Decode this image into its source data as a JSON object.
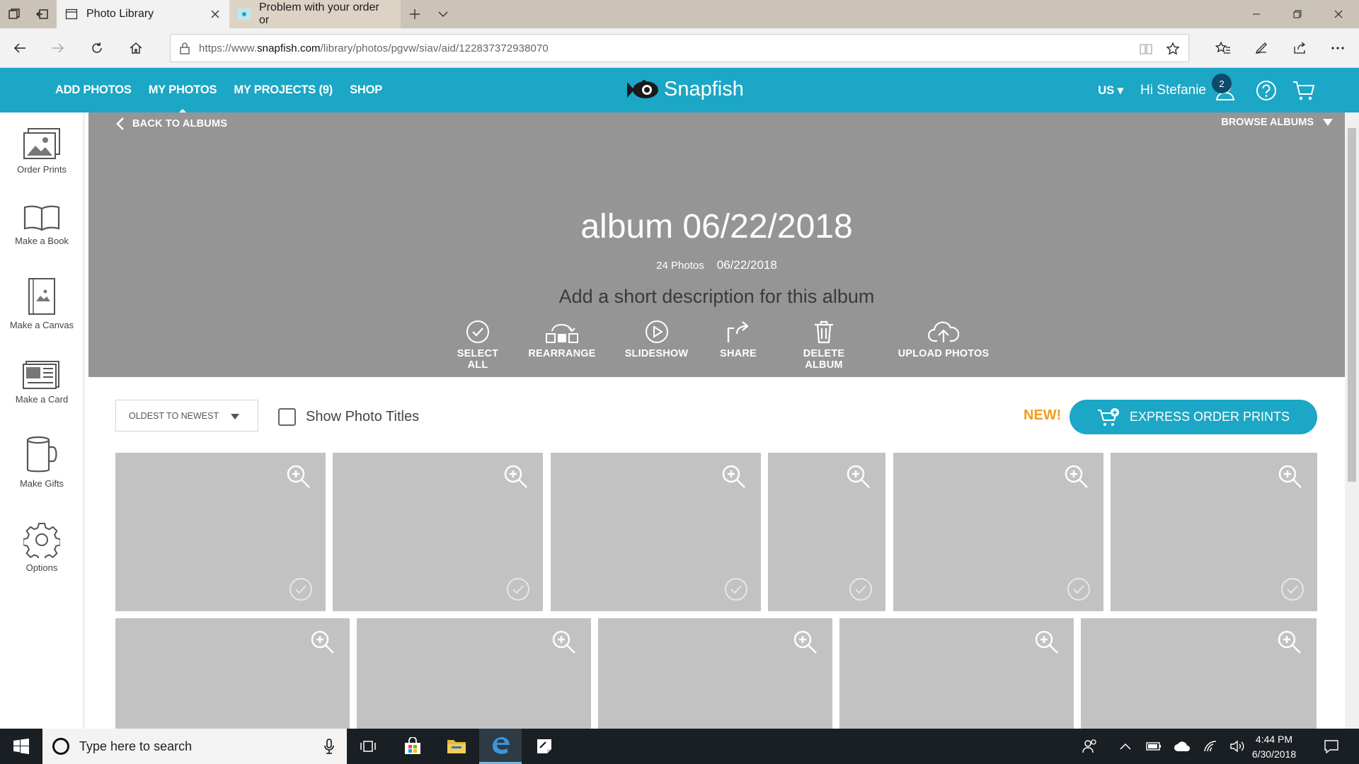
{
  "browser": {
    "tabs": [
      {
        "title": "Photo Library",
        "icon": "page-icon",
        "active": true
      },
      {
        "title": "Problem with your order or",
        "icon": "snapfish-favicon",
        "active": false
      }
    ],
    "url_prefix": "https://www.",
    "url_domain": "snapfish.com",
    "url_path": "/library/photos/pgvw/siav/aid/122837372938070"
  },
  "header": {
    "nav": [
      "ADD PHOTOS",
      "MY PHOTOS",
      "MY PROJECTS (9)",
      "SHOP"
    ],
    "active_nav": "MY PHOTOS",
    "logo": "Snapfish",
    "country": "US",
    "greeting": "Hi Stefanie",
    "notification_count": "2",
    "accent_color": "#1ba7c5"
  },
  "sidebar": {
    "items": [
      {
        "label": "Order Prints",
        "icon": "photo-prints-icon"
      },
      {
        "label": "Make a Book",
        "icon": "book-icon"
      },
      {
        "label": "Make a Canvas",
        "icon": "canvas-icon"
      },
      {
        "label": "Make a Card",
        "icon": "card-icon"
      },
      {
        "label": "Make Gifts",
        "icon": "mug-icon"
      },
      {
        "label": "Options",
        "icon": "gear-icon"
      }
    ]
  },
  "album": {
    "back_label": "BACK TO ALBUMS",
    "browse_label": "BROWSE ALBUMS",
    "title": "album 06/22/2018",
    "photo_count": "24 Photos",
    "date": "06/22/2018",
    "description_placeholder": "Add a short description for this album",
    "actions": [
      {
        "label": "SELECT ALL",
        "icon": "check-circle-icon"
      },
      {
        "label": "REARRANGE",
        "icon": "rearrange-icon"
      },
      {
        "label": "SLIDESHOW",
        "icon": "play-circle-icon"
      },
      {
        "label": "SHARE",
        "icon": "share-icon"
      },
      {
        "label": "DELETE ALBUM",
        "icon": "trash-icon"
      },
      {
        "label": "UPLOAD PHOTOS",
        "icon": "cloud-upload-icon"
      }
    ]
  },
  "toolbar": {
    "sort_selected": "OLDEST TO NEWEST",
    "show_titles_label": "Show Photo Titles",
    "new_label": "NEW!",
    "express_label": "EXPRESS ORDER PRINTS",
    "new_color": "#f39c1a"
  },
  "taskbar": {
    "search_placeholder": "Type here to search",
    "time": "4:44 PM",
    "date": "6/30/2018"
  }
}
